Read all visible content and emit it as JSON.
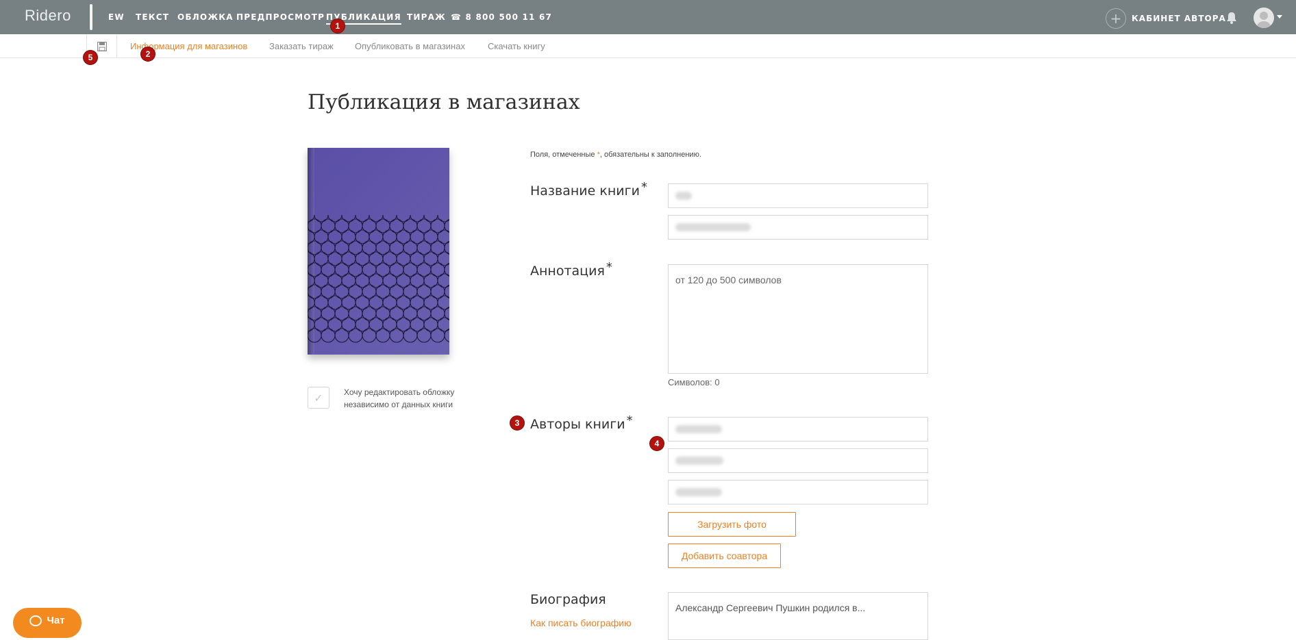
{
  "header": {
    "logo": "Ridero",
    "nav": [
      {
        "label": "EW"
      },
      {
        "label": "ТЕКСТ"
      },
      {
        "label": "ОБЛОЖКА"
      },
      {
        "label": "ПРЕДПРОСМОТР"
      },
      {
        "label": "ПУБЛИКАЦИЯ",
        "active": true
      },
      {
        "label": "ТИРАЖ"
      }
    ],
    "phone": "8 800 500 11 67",
    "cabinet_label": "КАБИНЕТ АВТОРА"
  },
  "subnav": {
    "tabs": [
      {
        "label": "Информация для магазинов",
        "active": true
      },
      {
        "label": "Заказать тираж"
      },
      {
        "label": "Опубликовать в магазинах"
      },
      {
        "label": "Скачать книгу"
      }
    ]
  },
  "badges": [
    "1",
    "2",
    "3",
    "4",
    "5"
  ],
  "main": {
    "title": "Публикация в магазинах",
    "required_note_prefix": "Поля, отмеченные ",
    "required_note_asterisk": "*",
    "required_note_suffix": ", обязательны к заполнению.",
    "cover_checkbox_label": "Хочу редактировать обложку независимо от данных книги",
    "book_title_label": "Название книги",
    "annotation_label": "Аннотация",
    "annotation_placeholder": "от 120 до 500 символов",
    "char_count": "Символов: 0",
    "authors_label": "Авторы книги",
    "upload_photo_button": "Загрузить фото",
    "add_coauthor_button": "Добавить соавтора",
    "biography_label": "Биография",
    "biography_link": "Как писать биографию",
    "biography_placeholder": "Александр Сергеевич Пушкин родился в...",
    "asterisk": "*"
  },
  "chat": {
    "label": "Чат"
  },
  "colors": {
    "accent": "#f07f1f",
    "header_bg": "#778184",
    "badge": "#b3130f"
  }
}
